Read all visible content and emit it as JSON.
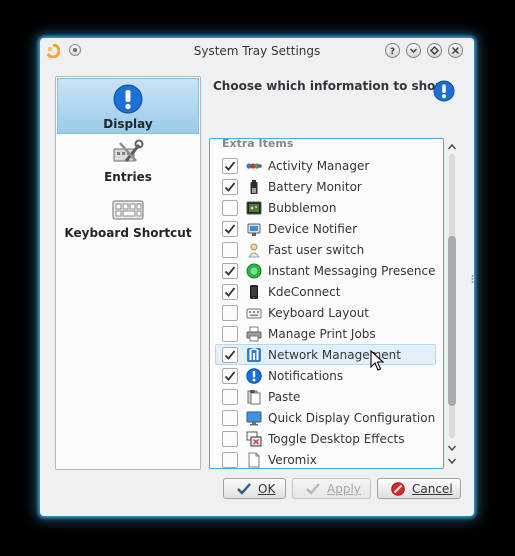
{
  "window": {
    "title": "System Tray Settings"
  },
  "titlebar_buttons": [
    "help-icon",
    "minimize-icon",
    "maximize-icon",
    "close-icon"
  ],
  "sidebar": {
    "items": [
      {
        "label": "Display",
        "icon": "info-icon",
        "selected": true
      },
      {
        "label": "Entries",
        "icon": "tools-icon",
        "selected": false
      },
      {
        "label": "Keyboard Shortcut",
        "icon": "keyboard-icon",
        "selected": false
      }
    ]
  },
  "main": {
    "header": "Choose which information to show",
    "header_icon": "info-icon",
    "group_label": "Extra Items",
    "items": [
      {
        "label": "Activity Manager",
        "checked": true,
        "icon": "activity-manager-icon"
      },
      {
        "label": "Battery Monitor",
        "checked": true,
        "icon": "battery-icon"
      },
      {
        "label": "Bubblemon",
        "checked": false,
        "icon": "bubblemon-icon"
      },
      {
        "label": "Device Notifier",
        "checked": true,
        "icon": "device-notifier-icon"
      },
      {
        "label": "Fast user switch",
        "checked": false,
        "icon": "user-switch-icon"
      },
      {
        "label": "Instant Messaging Presence",
        "checked": true,
        "icon": "presence-icon"
      },
      {
        "label": "KdeConnect",
        "checked": true,
        "icon": "phone-icon"
      },
      {
        "label": "Keyboard Layout",
        "checked": false,
        "icon": "keyboard-layout-icon"
      },
      {
        "label": "Manage Print Jobs",
        "checked": false,
        "icon": "printer-icon"
      },
      {
        "label": "Network Management",
        "checked": true,
        "icon": "network-icon",
        "hovered": true
      },
      {
        "label": "Notifications",
        "checked": true,
        "icon": "notifications-icon"
      },
      {
        "label": "Paste",
        "checked": false,
        "icon": "paste-icon"
      },
      {
        "label": "Quick Display Configuration",
        "checked": false,
        "icon": "display-icon"
      },
      {
        "label": "Toggle Desktop Effects",
        "checked": false,
        "icon": "desktop-effects-icon"
      },
      {
        "label": "Veromix",
        "checked": false,
        "icon": "veromix-icon"
      }
    ]
  },
  "buttons": {
    "ok": "OK",
    "apply": "Apply",
    "cancel": "Cancel"
  },
  "colors": {
    "accent": "#3daee9",
    "selection": "#9bcbe9",
    "info_blue": "#1d6fd6",
    "cancel_red": "#d62a2a",
    "check_blue": "#2a5d8f"
  }
}
